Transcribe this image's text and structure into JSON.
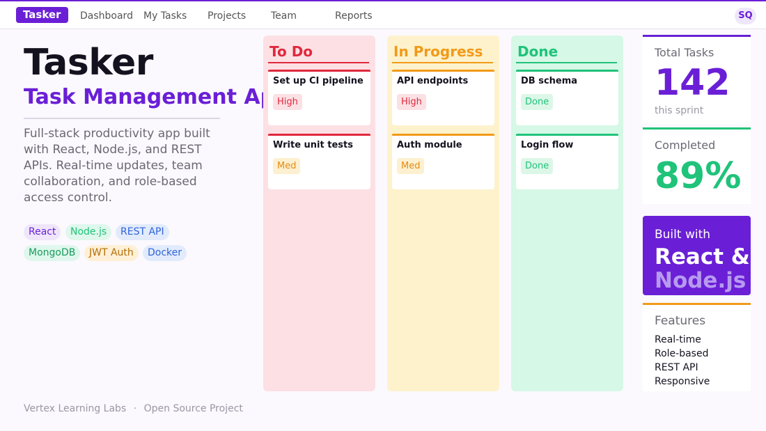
{
  "nav": {
    "brand": "Tasker",
    "items": [
      "Dashboard",
      "My Tasks",
      "Projects",
      "Team",
      "Reports"
    ],
    "avatar": "SQ"
  },
  "hero": {
    "title": "Tasker",
    "subtitle": "Task Management App",
    "description": "Full-stack productivity app built with React, Node.js, and REST APIs. Real-time updates, team collaboration, and role-based access control.",
    "tags": [
      "React",
      "Node.js",
      "REST API",
      "MongoDB",
      "JWT Auth",
      "Docker"
    ]
  },
  "board": {
    "columns": [
      {
        "title": "To Do",
        "color": "#e0283c",
        "cards": [
          {
            "title": "Set up CI pipeline",
            "badge": "High"
          },
          {
            "title": "Write unit tests",
            "badge": "Med"
          }
        ]
      },
      {
        "title": "In Progress",
        "color": "#f29a18",
        "cards": [
          {
            "title": "API endpoints",
            "badge": "High"
          },
          {
            "title": "Auth module",
            "badge": "Med"
          }
        ]
      },
      {
        "title": "Done",
        "color": "#1fc37a",
        "cards": [
          {
            "title": "DB schema",
            "badge": "Done"
          },
          {
            "title": "Login flow",
            "badge": "Done"
          }
        ]
      }
    ]
  },
  "stats": {
    "total": {
      "label": "Total Tasks",
      "value": "142",
      "note": "this sprint"
    },
    "completed": {
      "label": "Completed",
      "value": "89%"
    }
  },
  "built_with": {
    "label": "Built with",
    "line1": "React &",
    "line2": "Node.js"
  },
  "features": {
    "title": "Features",
    "items": [
      "Real-time",
      "Role-based",
      "REST API",
      "Responsive"
    ]
  },
  "footer": {
    "org": "Vertex Learning Labs",
    "separator": "·",
    "project": "Open Source Project"
  }
}
